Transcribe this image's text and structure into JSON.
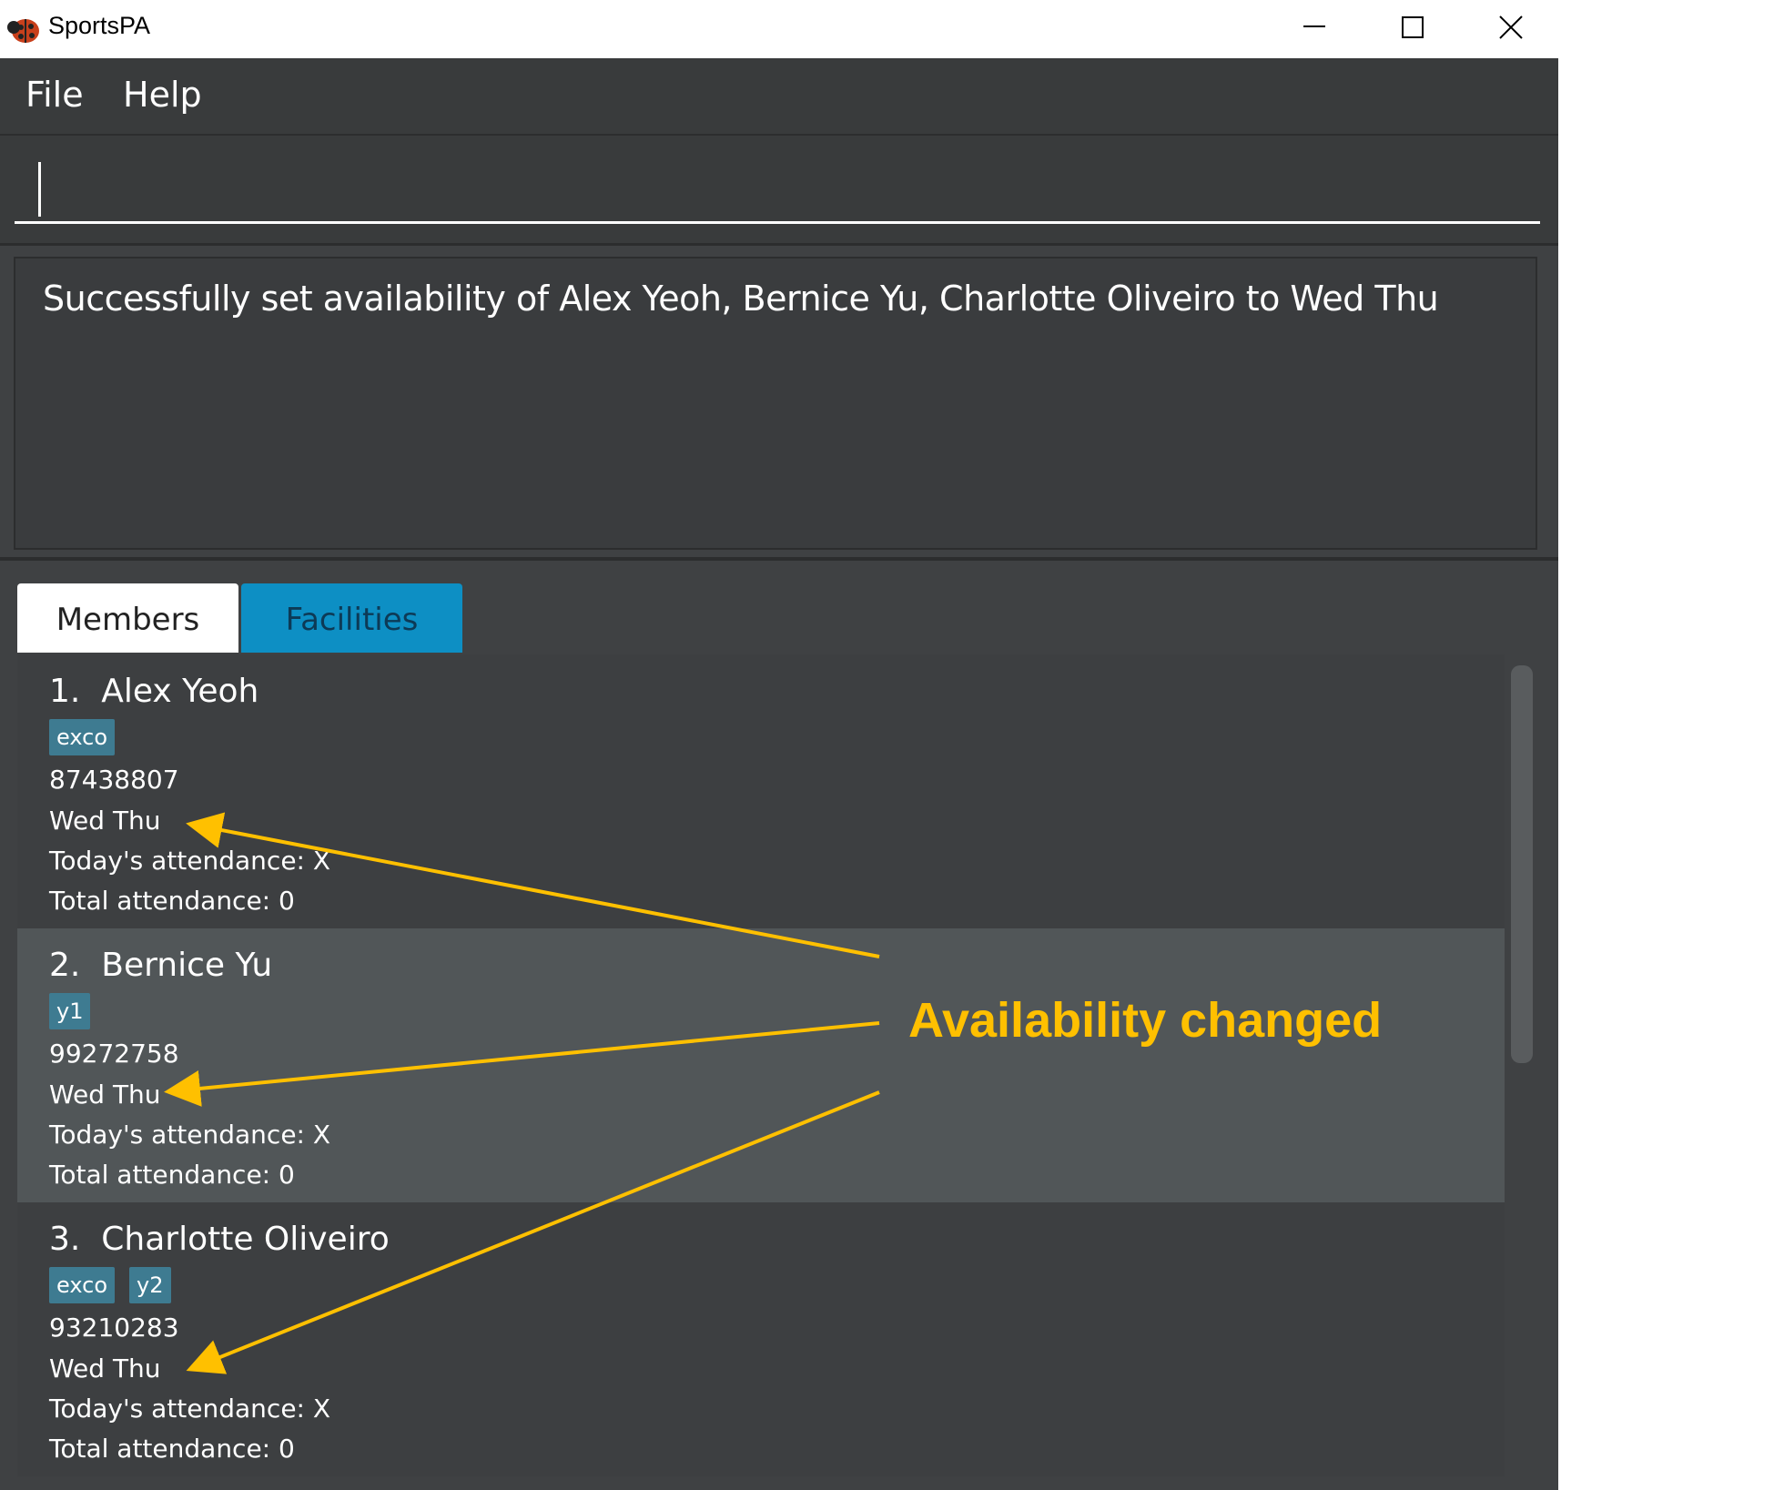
{
  "window": {
    "title": "SportsPA",
    "icon": "ladybug-icon"
  },
  "menu": {
    "items": [
      "File",
      "Help"
    ]
  },
  "command_box": {
    "value": "",
    "placeholder": ""
  },
  "result": {
    "message": "Successfully set availability of Alex Yeoh, Bernice Yu, Charlotte Oliveiro to Wed Thu"
  },
  "tabs": [
    {
      "label": "Members",
      "selected": true
    },
    {
      "label": "Facilities",
      "selected": false
    }
  ],
  "members": [
    {
      "index": "1.",
      "name": "Alex Yeoh",
      "tags": [
        "exco"
      ],
      "phone": "87438807",
      "availability": "Wed Thu",
      "today_attendance": "Today's attendance: X",
      "total_attendance": "Total attendance: 0"
    },
    {
      "index": "2.",
      "name": "Bernice Yu",
      "tags": [
        "y1"
      ],
      "phone": "99272758",
      "availability": "Wed Thu",
      "today_attendance": "Today's attendance: X",
      "total_attendance": "Total attendance: 0"
    },
    {
      "index": "3.",
      "name": "Charlotte Oliveiro",
      "tags": [
        "exco",
        "y2"
      ],
      "phone": "93210283",
      "availability": "Wed Thu",
      "today_attendance": "Today's attendance: X",
      "total_attendance": "Total attendance: 0"
    }
  ],
  "annotation": {
    "label": "Availability changed",
    "color": "#ffc000"
  },
  "colors": {
    "background": "#3f4143",
    "tab_selected": "#ffffff",
    "tab_unselected": "#0d8fc4",
    "tag": "#3e7b91"
  }
}
